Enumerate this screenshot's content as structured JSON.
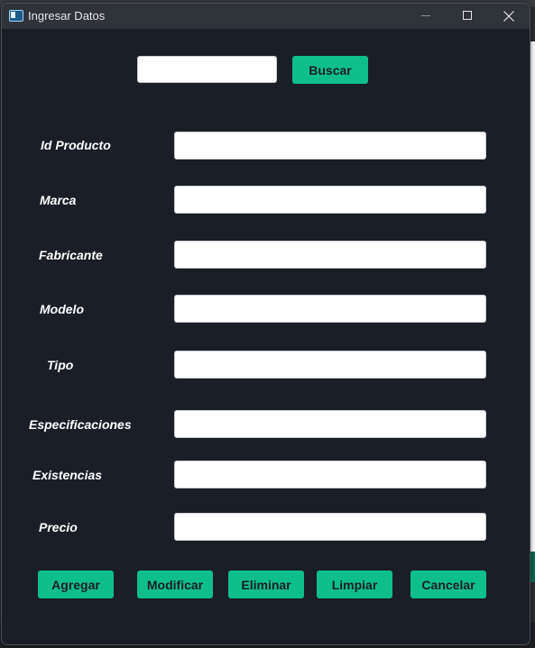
{
  "window": {
    "title": "Ingresar Datos",
    "icon": "window-app-icon"
  },
  "search": {
    "value": "",
    "button_label": "Buscar"
  },
  "form": {
    "fields": [
      {
        "label": "Id Producto",
        "value": ""
      },
      {
        "label": "Marca",
        "value": ""
      },
      {
        "label": "Fabricante",
        "value": ""
      },
      {
        "label": "Modelo",
        "value": ""
      },
      {
        "label": "Tipo",
        "value": ""
      },
      {
        "label": "Especificaciones",
        "value": ""
      },
      {
        "label": "Existencias",
        "value": ""
      },
      {
        "label": "Precio",
        "value": ""
      }
    ]
  },
  "actions": {
    "agregar": "Agregar",
    "modificar": "Modificar",
    "eliminar": "Eliminar",
    "limpiar": "Limpiar",
    "cancelar": "Cancelar"
  },
  "colors": {
    "window_bg": "#1a1e27",
    "accent": "#0fbf8b",
    "label_text": "#ffffff"
  }
}
